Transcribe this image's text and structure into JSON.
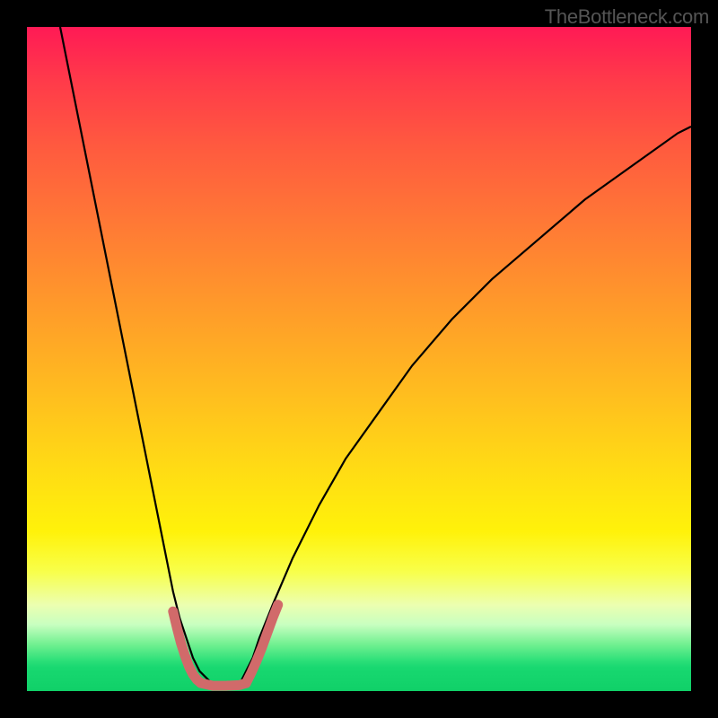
{
  "watermark": "TheBottleneck.com",
  "chart_data": {
    "type": "line",
    "title": "",
    "xlabel": "",
    "ylabel": "",
    "xlim": [
      0,
      100
    ],
    "ylim": [
      0,
      100
    ],
    "series": [
      {
        "name": "curve-left",
        "x": [
          5,
          7,
          9,
          11,
          13,
          15,
          17,
          19,
          20,
          21,
          22,
          23,
          24,
          25,
          26,
          27,
          28
        ],
        "values": [
          100,
          90,
          80,
          70,
          60,
          50,
          40,
          30,
          25,
          20,
          15,
          11,
          8,
          5,
          3,
          2,
          1
        ],
        "stroke": "#000",
        "width": 2.2
      },
      {
        "name": "curve-right",
        "x": [
          32,
          33,
          34,
          35,
          37,
          40,
          44,
          48,
          53,
          58,
          64,
          70,
          77,
          84,
          91,
          98,
          100
        ],
        "values": [
          1,
          3,
          5,
          8,
          13,
          20,
          28,
          35,
          42,
          49,
          56,
          62,
          68,
          74,
          79,
          84,
          85
        ],
        "stroke": "#000",
        "width": 2.2
      },
      {
        "name": "marker-left",
        "x": [
          22.0,
          22.6,
          23.2,
          23.8,
          24.4,
          25.0,
          25.6,
          26.2
        ],
        "values": [
          12.0,
          9.5,
          7.2,
          5.3,
          3.7,
          2.5,
          1.7,
          1.2
        ],
        "stroke": "#d16a6a",
        "width": 11,
        "linecap": "round"
      },
      {
        "name": "marker-bottom",
        "x": [
          26.2,
          28.0,
          30.0,
          32.0,
          33.0
        ],
        "values": [
          1.2,
          0.8,
          0.8,
          0.9,
          1.2
        ],
        "stroke": "#d16a6a",
        "width": 11,
        "linecap": "round"
      },
      {
        "name": "marker-right",
        "x": [
          33.0,
          33.8,
          34.6,
          35.4,
          36.2,
          37.0,
          37.8
        ],
        "values": [
          1.2,
          2.8,
          4.6,
          6.6,
          8.8,
          11.0,
          13.0
        ],
        "stroke": "#d16a6a",
        "width": 11,
        "linecap": "round"
      }
    ]
  }
}
